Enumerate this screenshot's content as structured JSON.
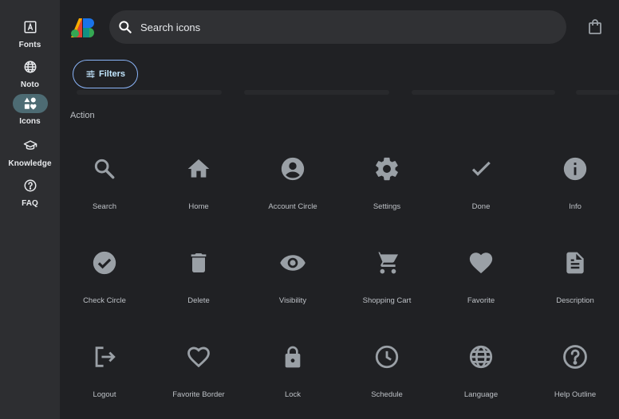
{
  "rail": {
    "items": [
      {
        "label": "Fonts",
        "icon": "fonts-icon"
      },
      {
        "label": "Noto",
        "icon": "globe-icon"
      },
      {
        "label": "Icons",
        "icon": "shapes-icon",
        "active": true
      },
      {
        "label": "Knowledge",
        "icon": "graduation-cap-icon"
      },
      {
        "label": "FAQ",
        "icon": "help-circle-icon"
      }
    ]
  },
  "search": {
    "placeholder": "Search icons"
  },
  "filters": {
    "label": "Filters"
  },
  "section": {
    "title": "Action"
  },
  "icons": [
    {
      "label": "Search",
      "icon": "search-icon"
    },
    {
      "label": "Home",
      "icon": "home-icon"
    },
    {
      "label": "Account Circle",
      "icon": "account-circle-icon"
    },
    {
      "label": "Settings",
      "icon": "settings-icon"
    },
    {
      "label": "Done",
      "icon": "done-icon"
    },
    {
      "label": "Info",
      "icon": "info-icon"
    },
    {
      "label": "Check Circle",
      "icon": "check-circle-icon"
    },
    {
      "label": "Delete",
      "icon": "delete-icon"
    },
    {
      "label": "Visibility",
      "icon": "visibility-icon"
    },
    {
      "label": "Shopping Cart",
      "icon": "shopping-cart-icon"
    },
    {
      "label": "Favorite",
      "icon": "favorite-icon"
    },
    {
      "label": "Description",
      "icon": "description-icon"
    },
    {
      "label": "Logout",
      "icon": "logout-icon"
    },
    {
      "label": "Favorite Border",
      "icon": "favorite-border-icon"
    },
    {
      "label": "Lock",
      "icon": "lock-icon"
    },
    {
      "label": "Schedule",
      "icon": "schedule-icon"
    },
    {
      "label": "Language",
      "icon": "language-icon"
    },
    {
      "label": "Help Outline",
      "icon": "help-outline-icon"
    }
  ],
  "colors": {
    "background": "#202124",
    "rail": "#2d2e31",
    "active_pill": "#4d6b73",
    "icon": "#9aa0a6",
    "accent": "#8ab4f8"
  }
}
